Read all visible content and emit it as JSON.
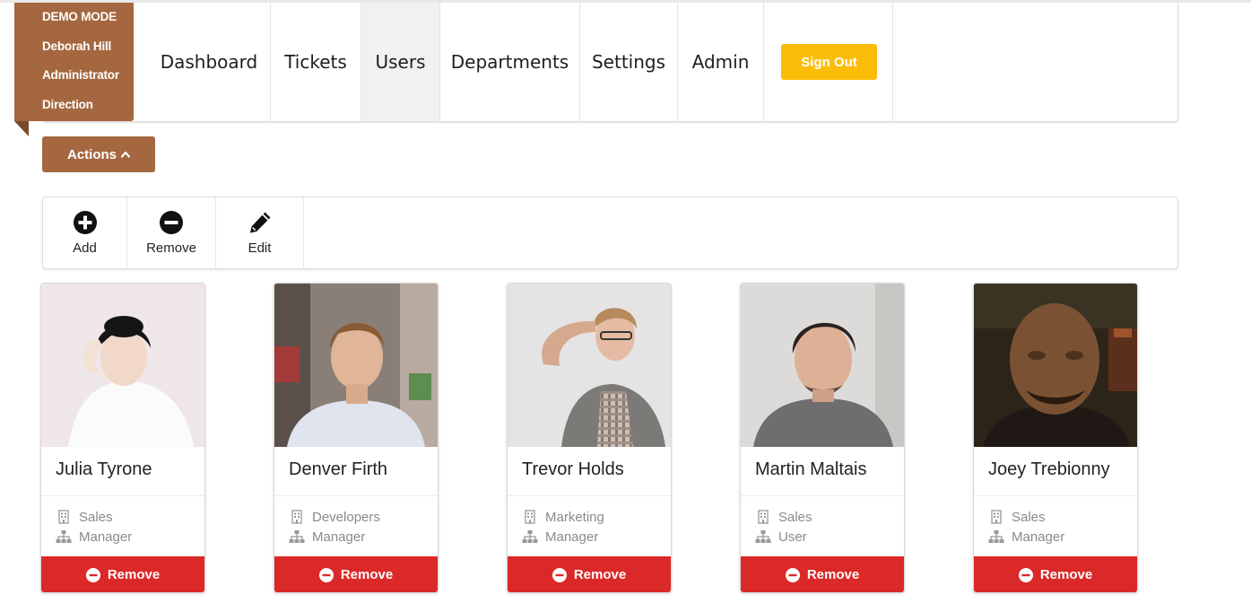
{
  "demo": {
    "mode": "DEMO MODE",
    "user_name": "Deborah Hill",
    "role": "Administrator",
    "department": "Direction"
  },
  "nav": {
    "items": [
      {
        "label": "Dashboard"
      },
      {
        "label": "Tickets"
      },
      {
        "label": "Users"
      },
      {
        "label": "Departments"
      },
      {
        "label": "Settings"
      },
      {
        "label": "Admin"
      }
    ],
    "active": "Users",
    "signout_label": "Sign Out"
  },
  "actions": {
    "label": "Actions",
    "icon": "chevron-up-icon"
  },
  "toolbar": {
    "add_label": "Add",
    "remove_label": "Remove",
    "edit_label": "Edit"
  },
  "users": [
    {
      "name": "Julia Tyrone",
      "department": "Sales",
      "role": "Manager",
      "remove_label": "Remove"
    },
    {
      "name": "Denver Firth",
      "department": "Developers",
      "role": "Manager",
      "remove_label": "Remove"
    },
    {
      "name": "Trevor Holds",
      "department": "Marketing",
      "role": "Manager",
      "remove_label": "Remove"
    },
    {
      "name": "Martin Maltais",
      "department": "Sales",
      "role": "User",
      "remove_label": "Remove"
    },
    {
      "name": "Joey Trebionny",
      "department": "Sales",
      "role": "Manager",
      "remove_label": "Remove"
    }
  ],
  "colors": {
    "brown": "#a5673f",
    "yellow": "#fbbd08",
    "red": "#db2828"
  }
}
